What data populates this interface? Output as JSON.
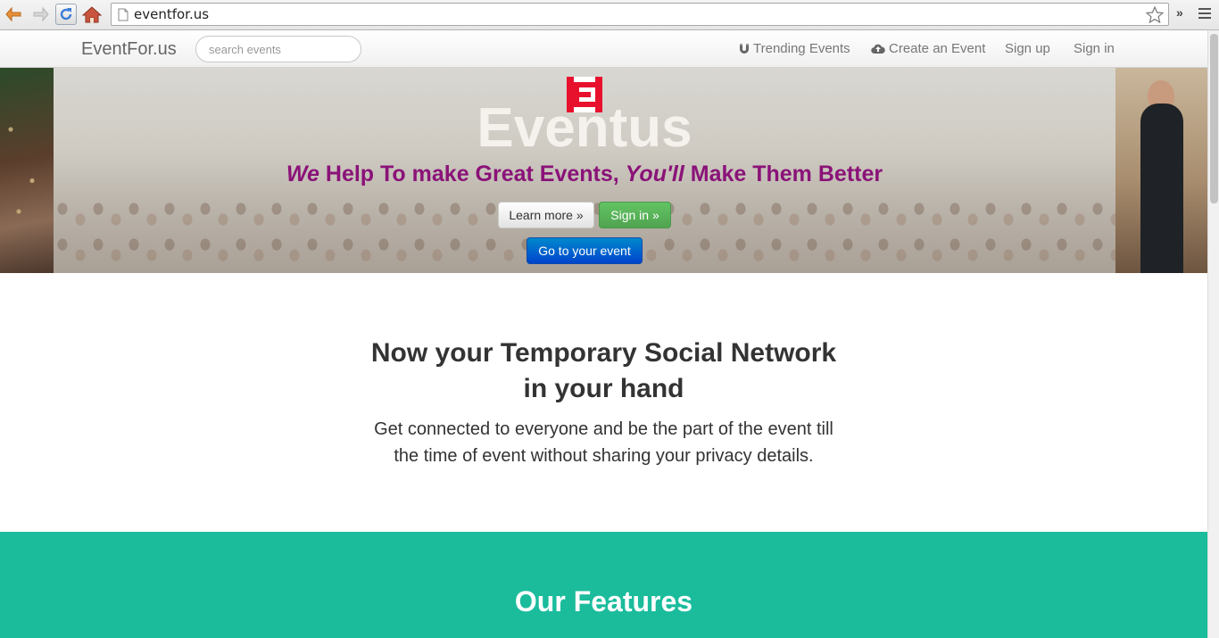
{
  "browser": {
    "url": "eventfor.us",
    "more_label": "»",
    "icons": {
      "back": "arrow-left-icon",
      "forward": "arrow-right-icon",
      "reload": "reload-icon",
      "home": "home-icon",
      "page": "page-icon",
      "bookmark": "star-icon",
      "menu": "menu-icon"
    }
  },
  "navbar": {
    "brand": "EventFor.us",
    "search_placeholder": "search events",
    "links": {
      "trending": "Trending Events",
      "create": "Create an Event",
      "signup": "Sign up",
      "signin": "Sign in"
    }
  },
  "hero": {
    "logo_letter": "E",
    "title": "Eventus",
    "tagline": {
      "part1": "We",
      "part2": " Help To make Great Events, ",
      "part3": "You'll",
      "part4": " Make Them Better"
    },
    "buttons": {
      "learn_more": "Learn more »",
      "sign_in": "Sign in »",
      "go_to_event": "Go to your event"
    }
  },
  "intro": {
    "heading_line1": "Now your Temporary Social Network",
    "heading_line2": "in your hand",
    "text_line1": "Get connected to everyone and be the part of the event till",
    "text_line2": "the time of event without sharing your privacy details."
  },
  "features": {
    "heading": "Our Features"
  },
  "colors": {
    "tagline": "#8a1278",
    "logo_red": "#e8112d",
    "features_bg": "#1abc9c",
    "signin_green": "#5bb75b",
    "goto_blue": "#0a66cc"
  }
}
